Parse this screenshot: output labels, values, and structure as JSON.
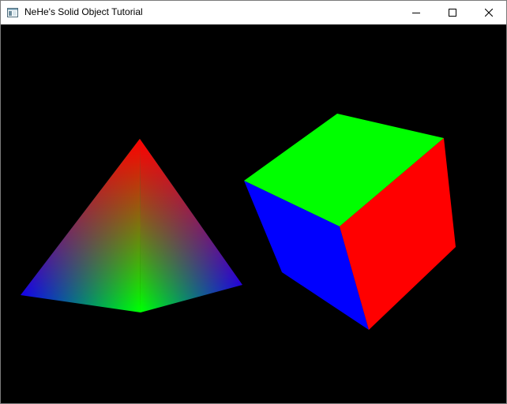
{
  "window": {
    "title": "NeHe's Solid Object Tutorial",
    "icon": "application-window-icon",
    "controls": {
      "minimize_icon": "minimize-icon",
      "maximize_icon": "maximize-icon",
      "close_icon": "close-icon"
    }
  },
  "scene": {
    "background": "#000000",
    "pyramid": {
      "apex_color": "#ff0000",
      "front_color": "#00ff00",
      "side_color": "#0000ff"
    },
    "cube": {
      "top_color": "#00ff00",
      "right_color": "#ff0000",
      "left_color": "#0000ff"
    }
  }
}
